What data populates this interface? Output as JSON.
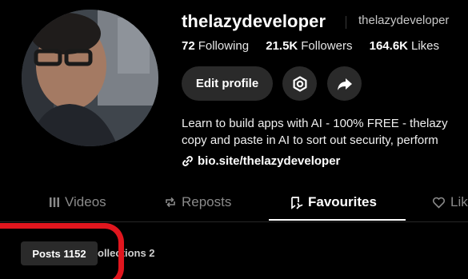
{
  "profile": {
    "username": "thelazydeveloper",
    "nickname": "thelazydeveloper",
    "stats": {
      "following_value": "72",
      "following_label": "Following",
      "followers_value": "21.5K",
      "followers_label": "Followers",
      "likes_value": "164.6K",
      "likes_label": "Likes"
    },
    "edit_button_label": "Edit profile",
    "bio_line1": "Learn to build apps with AI - 100% FREE - thelazy",
    "bio_line2": "copy and paste in AI to sort out security, perform",
    "link_text": "bio.site/thelazydeveloper"
  },
  "tabs": [
    {
      "label": "Videos",
      "icon": "grid-icon",
      "active": false
    },
    {
      "label": "Reposts",
      "icon": "repost-icon",
      "active": false
    },
    {
      "label": "Favourites",
      "icon": "bookmark-icon",
      "active": true
    },
    {
      "label": "Lik",
      "icon": "heart-icon",
      "active": false
    }
  ],
  "subtabs": {
    "posts_label": "Posts 1152",
    "collections_label": "ollections 2"
  },
  "colors": {
    "background": "#000000",
    "button_bg": "#2a2a2a",
    "highlight": "#e0161e"
  }
}
